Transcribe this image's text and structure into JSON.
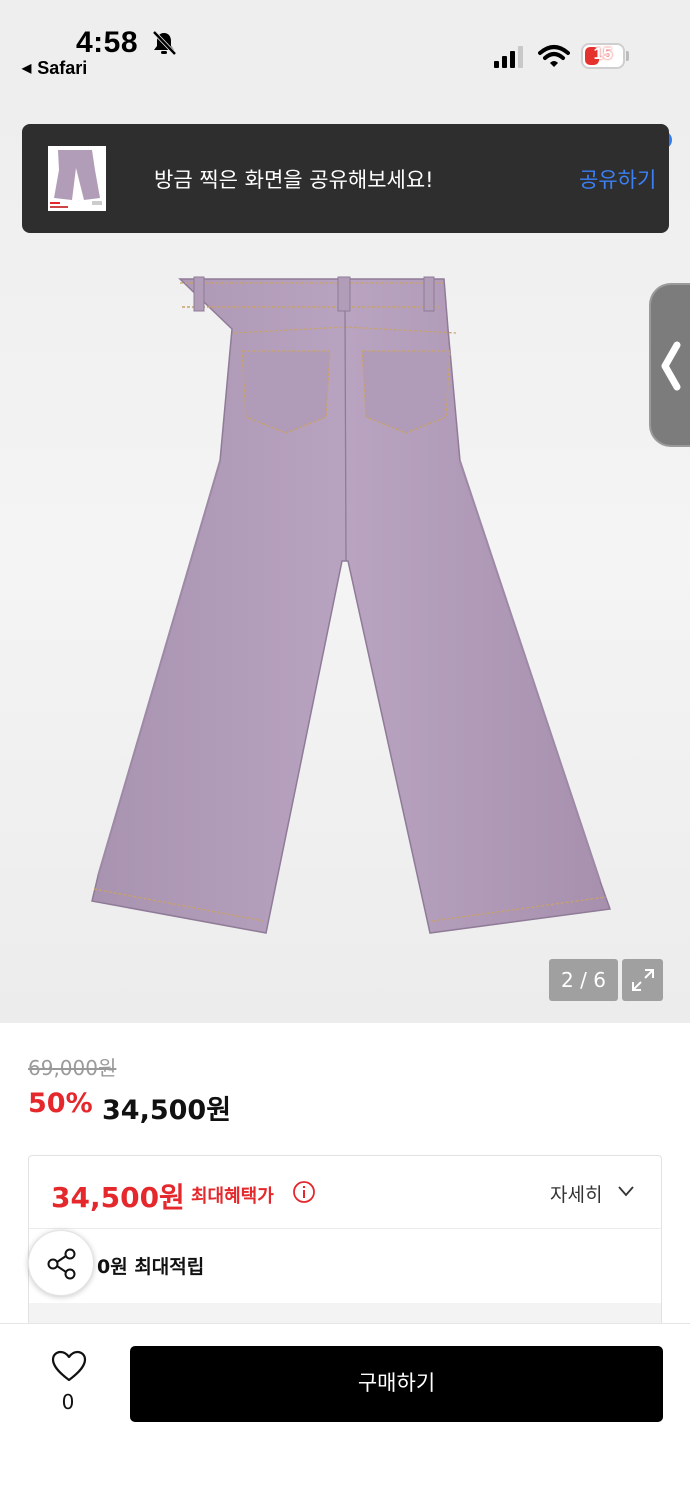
{
  "status_bar": {
    "time": "4:58",
    "back_app": "Safari",
    "battery": "15",
    "icons": [
      "bell-slash-icon",
      "signal-icon",
      "wifi-icon",
      "battery-icon"
    ]
  },
  "toast": {
    "message": "방금 찍은 화면을 공유해보세요!",
    "action": "공유하기",
    "action_color": "#3b7ff5"
  },
  "gallery": {
    "pager": "2 / 6",
    "product_color": "#b29db9"
  },
  "price": {
    "original": "69,000원",
    "discount": "50%",
    "sale": "34,500원",
    "accent_color": "#e4282c"
  },
  "benefit": {
    "max_price": "34,500원",
    "max_label": "최대혜택가",
    "detail_toggle": "자세히",
    "points": "0원 최대적립"
  },
  "bottom_bar": {
    "like_count": "0",
    "buy_label": "구매하기"
  }
}
